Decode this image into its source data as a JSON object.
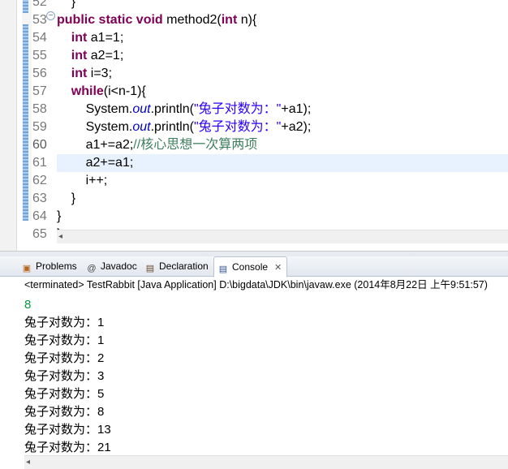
{
  "editor": {
    "line_numbers": [
      "52",
      "53",
      "54",
      "55",
      "56",
      "57",
      "58",
      "59",
      "60",
      "61",
      "62",
      "63",
      "64",
      "65"
    ],
    "code": {
      "l52": "}",
      "l53_kw": "public static void",
      "l53_rest": " method2(",
      "l53_kw2": "int",
      "l53_end": " n){",
      "l54_kw": "int",
      "l54_rest": " a1=1;",
      "l55_kw": "int",
      "l55_rest": " a2=1;",
      "l56_kw": "int",
      "l56_rest": " i=3;",
      "l57_kw": "while",
      "l57_rest": "(i<n-1){",
      "l58_a": "System.",
      "l58_field": "out",
      "l58_b": ".println(",
      "l58_str": "\"兔子对数为：\"",
      "l58_c": "+a1);",
      "l59_a": "System.",
      "l59_field": "out",
      "l59_b": ".println(",
      "l59_str": "\"兔子对数为：\"",
      "l59_c": "+a2);",
      "l60_code": "a1+=a2;",
      "l60_comment": "//核心思想一次算两项",
      "l61": "a2+=a1;",
      "l62": "i++;",
      "l63": "}",
      "l64": "}",
      "l65": "}"
    },
    "fold_icon": "collapse-icon"
  },
  "console_view": {
    "tabs": [
      {
        "label": "Problems",
        "icon": "problems-icon"
      },
      {
        "label": "Javadoc",
        "icon": "at-icon"
      },
      {
        "label": "Declaration",
        "icon": "declaration-icon"
      },
      {
        "label": "Console",
        "icon": "console-icon"
      }
    ],
    "header": "<terminated> TestRabbit [Java Application] D:\\bigdata\\JDK\\bin\\javaw.exe (2014年8月22日 上午9:51:57)",
    "input_line": "8",
    "output": [
      "兔子对数为：1",
      "兔子对数为：1",
      "兔子对数为：2",
      "兔子对数为：3",
      "兔子对数为：5",
      "兔子对数为：8",
      "兔子对数为：13",
      "兔子对数为：21"
    ]
  }
}
